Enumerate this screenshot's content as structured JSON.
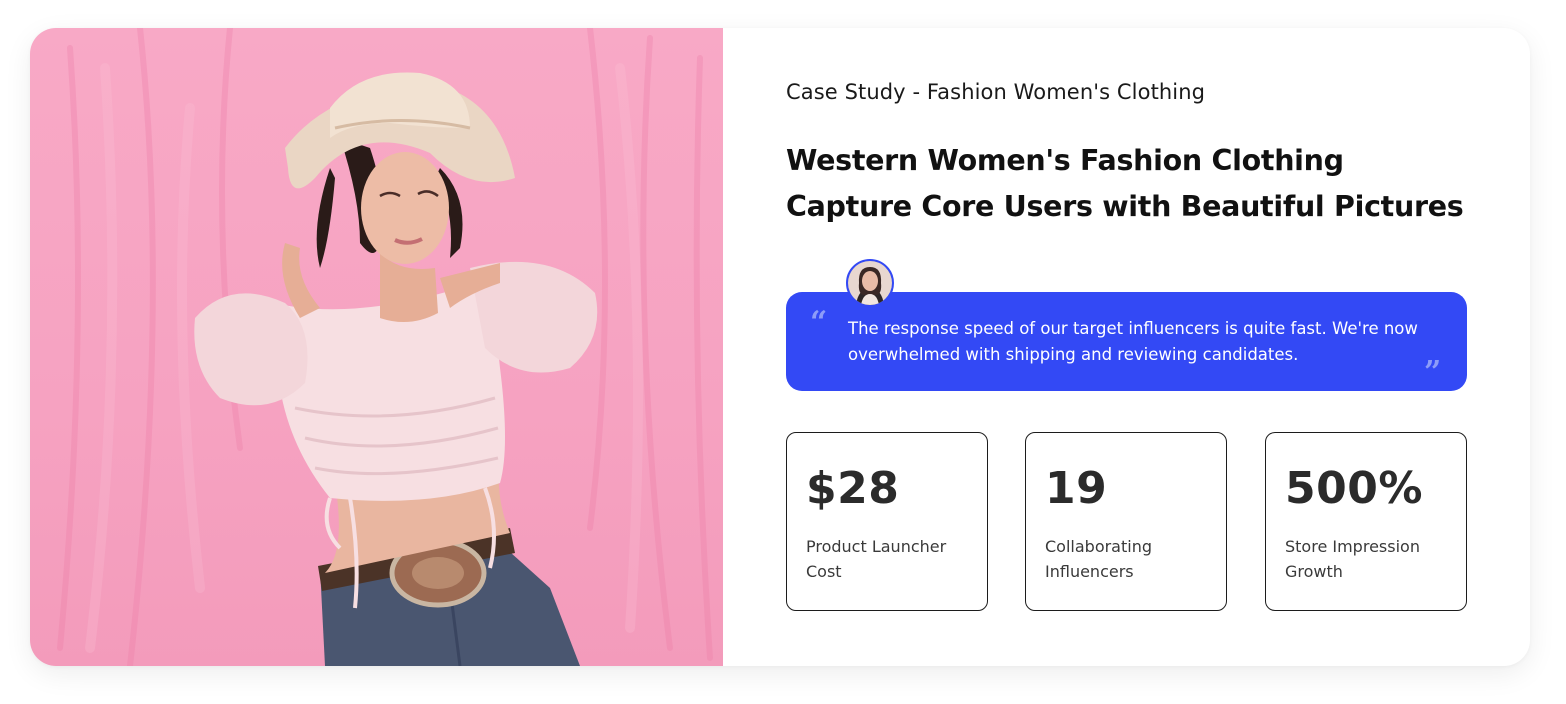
{
  "case_study": {
    "eyebrow": "Case Study - Fashion Women's Clothing",
    "headline_line1": "Western Women's Fashion Clothing",
    "headline_line2": "Capture Core Users with Beautiful Pictures"
  },
  "testimonial": {
    "quote": "The response speed of our target influencers is quite fast. We're now overwhelmed with shipping and reviewing candidates.",
    "open_mark": "“",
    "close_mark": "”"
  },
  "stats": [
    {
      "value": "$28",
      "label": "Product Launcher Cost"
    },
    {
      "value": "19",
      "label": "Collaborating Influencers"
    },
    {
      "value": "500%",
      "label": "Store Impression Growth"
    }
  ],
  "colors": {
    "accent": "#3349f5",
    "photo_background": "#f6a2c1",
    "card_background": "#ffffff"
  },
  "image": {
    "subject": "Woman in cowboy hat and white crop top against a pink background"
  }
}
